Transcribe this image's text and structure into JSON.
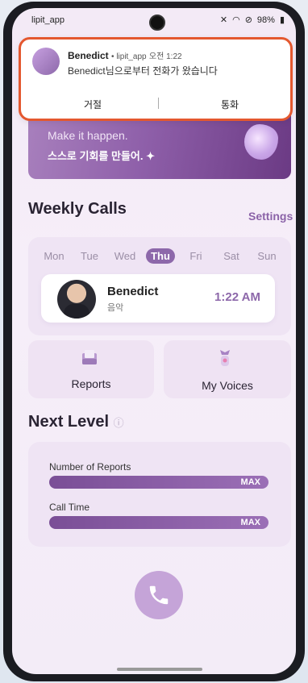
{
  "status_bar": {
    "app_name": "lipit_app",
    "battery": "98%"
  },
  "notification": {
    "caller": "Benedict",
    "app": "lipit_app",
    "time": "오전 1:22",
    "message": "Benedict님으로부터 전화가 왔습니다",
    "decline_label": "거절",
    "answer_label": "통화"
  },
  "hero": {
    "line1": "Make it happen.",
    "line2": "스스로 기회를 만들어. ✦"
  },
  "weekly_calls": {
    "title": "Weekly Calls",
    "settings_label": "Settings",
    "days": [
      "Mon",
      "Tue",
      "Wed",
      "Thu",
      "Fri",
      "Sat",
      "Sun"
    ],
    "selected_day": "Thu",
    "call": {
      "name": "Benedict",
      "subtitle": "음악",
      "time": "1:22 AM"
    }
  },
  "tiles": {
    "reports": "Reports",
    "my_voices": "My Voices"
  },
  "next_level": {
    "title": "Next Level",
    "metrics": [
      {
        "label": "Number of Reports",
        "value": "MAX"
      },
      {
        "label": "Call Time",
        "value": "MAX"
      }
    ]
  }
}
